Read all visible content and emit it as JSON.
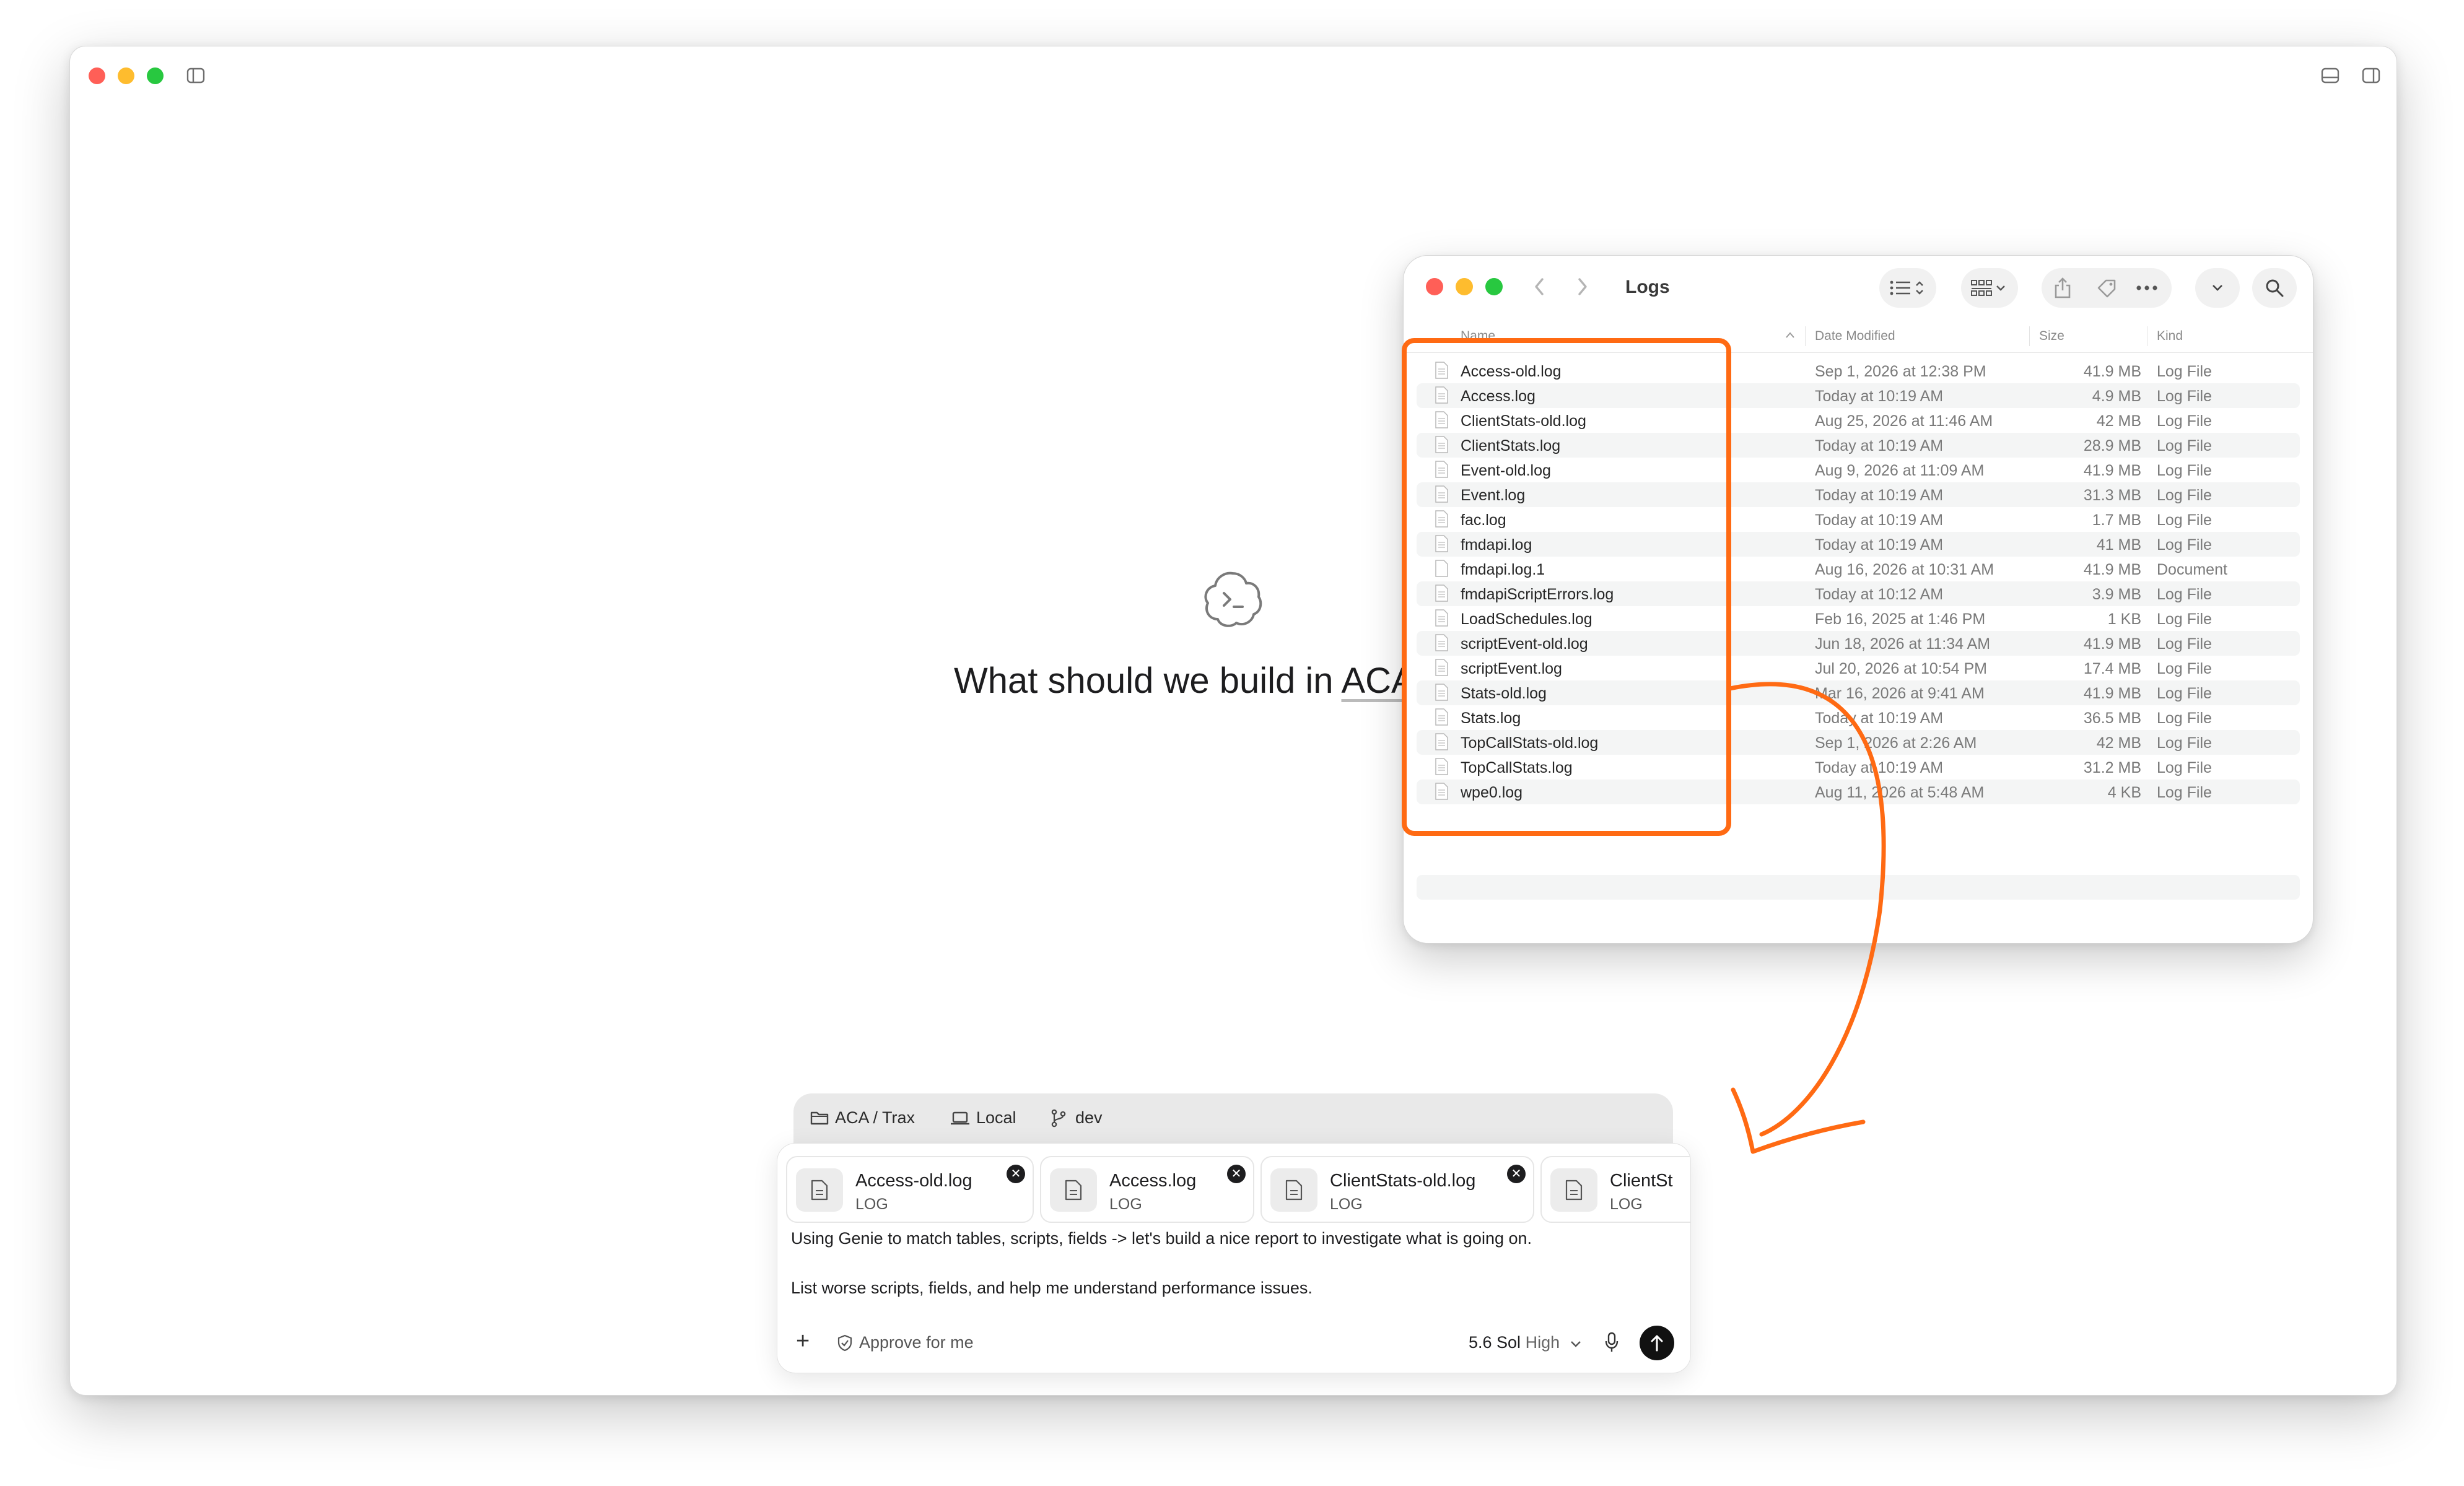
{
  "window": {
    "traffic_lights": [
      "#ff5f57",
      "#febc2e",
      "#28c840"
    ],
    "left_icons": [
      "sidebar-toggle-icon"
    ],
    "right_icons": [
      "terminal-panel-icon",
      "right-sidebar-icon"
    ]
  },
  "hero": {
    "icon": "codex-cloud-terminal-icon",
    "title_prefix": "What should we build in ",
    "project": "ACA"
  },
  "finder": {
    "title": "Logs",
    "toolbar_icons": [
      "back-chevron-icon",
      "forward-chevron-icon",
      "list-view-icon",
      "group-by-icon",
      "share-icon",
      "tag-icon",
      "more-icon",
      "expand-chevron-icon",
      "search-icon"
    ],
    "columns": {
      "name": "Name",
      "date": "Date Modified",
      "size": "Size",
      "kind": "Kind"
    },
    "files": [
      {
        "name": "Access-old.log",
        "date": "Sep 1, 2026 at 12:38 PM",
        "size": "41.9 MB",
        "kind": "Log File"
      },
      {
        "name": "Access.log",
        "date": "Today at 10:19 AM",
        "size": "4.9 MB",
        "kind": "Log File"
      },
      {
        "name": "ClientStats-old.log",
        "date": "Aug 25, 2026 at 11:46 AM",
        "size": "42 MB",
        "kind": "Log File"
      },
      {
        "name": "ClientStats.log",
        "date": "Today at 10:19 AM",
        "size": "28.9 MB",
        "kind": "Log File"
      },
      {
        "name": "Event-old.log",
        "date": "Aug 9, 2026 at 11:09 AM",
        "size": "41.9 MB",
        "kind": "Log File"
      },
      {
        "name": "Event.log",
        "date": "Today at 10:19 AM",
        "size": "31.3 MB",
        "kind": "Log File"
      },
      {
        "name": "fac.log",
        "date": "Today at 10:19 AM",
        "size": "1.7 MB",
        "kind": "Log File"
      },
      {
        "name": "fmdapi.log",
        "date": "Today at 10:19 AM",
        "size": "41 MB",
        "kind": "Log File"
      },
      {
        "name": "fmdapi.log.1",
        "date": "Aug 16, 2026 at 10:31 AM",
        "size": "41.9 MB",
        "kind": "Document"
      },
      {
        "name": "fmdapiScriptErrors.log",
        "date": "Today at 10:12 AM",
        "size": "3.9 MB",
        "kind": "Log File"
      },
      {
        "name": "LoadSchedules.log",
        "date": "Feb 16, 2025 at 1:46 PM",
        "size": "1 KB",
        "kind": "Log File"
      },
      {
        "name": "scriptEvent-old.log",
        "date": "Jun 18, 2026 at 11:34 AM",
        "size": "41.9 MB",
        "kind": "Log File"
      },
      {
        "name": "scriptEvent.log",
        "date": "Jul 20, 2026 at 10:54 PM",
        "size": "17.4 MB",
        "kind": "Log File"
      },
      {
        "name": "Stats-old.log",
        "date": "Mar 16, 2026 at 9:41 AM",
        "size": "41.9 MB",
        "kind": "Log File"
      },
      {
        "name": "Stats.log",
        "date": "Today at 10:19 AM",
        "size": "36.5 MB",
        "kind": "Log File"
      },
      {
        "name": "TopCallStats-old.log",
        "date": "Sep 1, 2026 at 2:26 AM",
        "size": "42 MB",
        "kind": "Log File"
      },
      {
        "name": "TopCallStats.log",
        "date": "Today at 10:19 AM",
        "size": "31.2 MB",
        "kind": "Log File"
      },
      {
        "name": "wpe0.log",
        "date": "Aug 11, 2026 at 5:48 AM",
        "size": "4 KB",
        "kind": "Log File"
      }
    ]
  },
  "annotation": {
    "color": "#ff6a13"
  },
  "composer": {
    "context": {
      "project": "ACA / Trax",
      "environment": "Local",
      "branch": "dev"
    },
    "attachments": [
      {
        "name": "Access-old.log",
        "type": "LOG"
      },
      {
        "name": "Access.log",
        "type": "LOG"
      },
      {
        "name": "ClientStats-old.log",
        "type": "LOG"
      },
      {
        "name": "ClientSt",
        "type": "LOG"
      }
    ],
    "prompt_line1": "Using Genie to match tables, scripts, fields -> let's build a nice report to investigate what is going on.",
    "prompt_line2": "List worse scripts, fields, and help me understand performance issues.",
    "add_label": "+",
    "approve_label": "Approve for me",
    "model": "5.6 Sol",
    "effort": "High"
  }
}
